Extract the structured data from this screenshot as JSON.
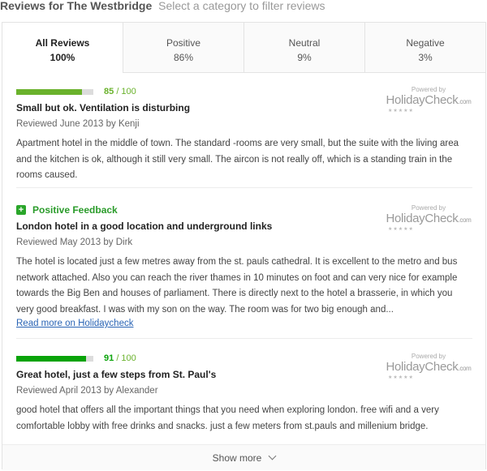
{
  "header": {
    "title": "Reviews for The Westbridge",
    "subtitle": "Select a category to filter reviews"
  },
  "tabs": [
    {
      "label": "All Reviews",
      "percent": "100%",
      "active": true
    },
    {
      "label": "Positive",
      "percent": "86%",
      "active": false
    },
    {
      "label": "Neutral",
      "percent": "9%",
      "active": false
    },
    {
      "label": "Negative",
      "percent": "3%",
      "active": false
    }
  ],
  "colors": {
    "score_high": "#0aa30a",
    "score_mid": "#6ab22c",
    "positive": "#2a9b2a",
    "link": "#2a64b5"
  },
  "reviews": [
    {
      "score": "85",
      "score_max": "/ 100",
      "score_fraction": 0.85,
      "title": "Small but ok. Ventilation is disturbing",
      "meta": "Reviewed June 2013 by Kenji",
      "text": "Apartment hotel in the middle of town. The standard -rooms are very small, but the suite with the living area and the kitchen is ok, although it still very small. The aircon is not really off, which is a standing train in the rooms caused."
    },
    {
      "feedback_label": "Positive Feedback",
      "title": "London hotel in a good location and underground links",
      "meta": "Reviewed May 2013 by Dirk",
      "text": "The hotel is located just a few metres away from the st. pauls cathedral. It is excellent to the metro and bus network attached. Also you can reach the river thames in 10 minutes on foot and can very nice for example towards the Big Ben and houses of parliament. There is directly next to the hotel a brasserie, in which you very good breakfast. I was with my son on the way. The room was for two big enough and...",
      "read_more": "Read more on Holidaycheck"
    },
    {
      "score": "91",
      "score_max": "/ 100",
      "score_fraction": 0.91,
      "title": "Great hotel, just a few steps from St. Paul's",
      "meta": "Reviewed April 2013 by Alexander",
      "text": "good hotel that offers all the important things that you need when exploring london. free wifi and a very comfortable lobby with free drinks and snacks. just a few meters from st.pauls and millenium bridge."
    }
  ],
  "badge": {
    "powered": "Powered by",
    "logo": "HolidayCheck",
    "domain": ".com"
  },
  "show_more": "Show more"
}
